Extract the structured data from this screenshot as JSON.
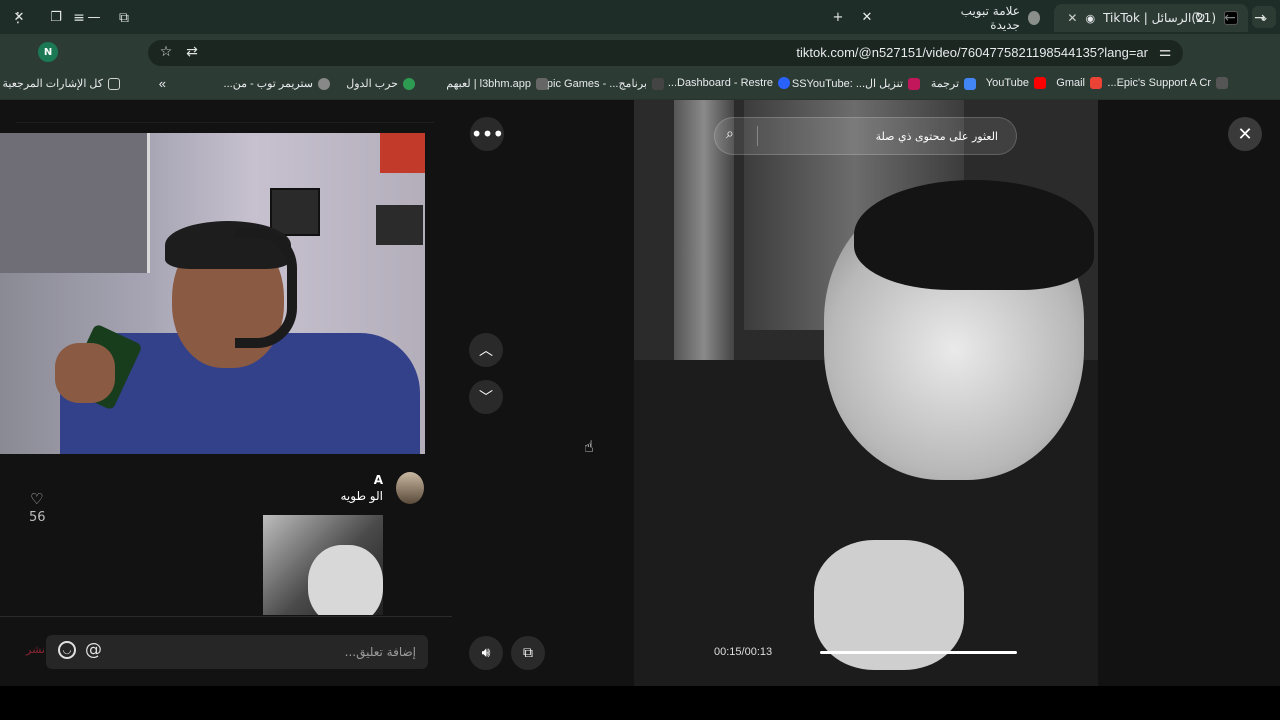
{
  "tabs": [
    {
      "label": "(21)الرسائل | TikTok",
      "active": true
    },
    {
      "label": "علامة تبويب جديدة",
      "active": false
    }
  ],
  "toolbar": {
    "url": "tiktok.com/@n527151/video/7604775821198544135?lang=ar",
    "profile_initial": "N"
  },
  "bookmarks": [
    {
      "label": "Epic's Support A Cr..."
    },
    {
      "label": "Gmail"
    },
    {
      "label": "YouTube"
    },
    {
      "label": "ترجمة"
    },
    {
      "label": "تنزيل ال... :SSYouTube"
    },
    {
      "label": "Dashboard - Restre..."
    },
    {
      "label": "برنامج... - Epic Games"
    },
    {
      "label": "l3bhm.app | لعبهم"
    },
    {
      "label": "حرب الدول"
    },
    {
      "label": "ستريمر توب - من..."
    },
    {
      "label": "كل الإشارات المرجعية"
    }
  ],
  "left": {
    "user_name": "A",
    "caption": "الو طويه",
    "like_count": "56",
    "comment_placeholder": "إضافة تعليق...",
    "post_label": "نشر"
  },
  "player": {
    "search_placeholder": "العثور على محتوى ذي صلة",
    "time": "00:15/00:13",
    "progress": 1.0
  },
  "icons": [
    "more-icon",
    "chevron-up-icon",
    "chevron-down-icon",
    "volume-icon",
    "pip-icon",
    "close-icon",
    "search-icon",
    "heart-icon",
    "emoji-icon",
    "mention-icon"
  ]
}
